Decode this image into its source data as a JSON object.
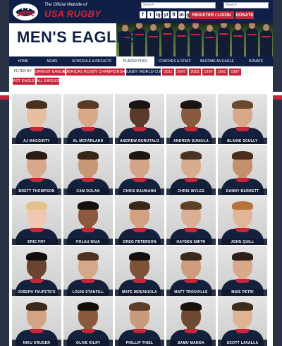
{
  "header": {
    "logo_subtitle": "The Official Website of",
    "logo_title": "USA RUGBY",
    "search_placeholder_1": "Search",
    "search_placeholder_2": "Search",
    "social_icons": [
      "f",
      "t",
      "ig",
      "yt",
      "fl",
      "in",
      "g+"
    ],
    "register_login_label": "REGISTER / LOGIN",
    "donate_label": "DONATE"
  },
  "banner": {
    "title": "MEN'S EAGLES"
  },
  "nav": {
    "items": [
      {
        "label": "HOME"
      },
      {
        "label": "NEWS"
      },
      {
        "label": "SCHEDULE & RESULTS"
      },
      {
        "label": "PLAYER POOL"
      },
      {
        "label": "COACHES & STAFF"
      },
      {
        "label": "BECOME AN EAGLE"
      },
      {
        "label": "DONATE"
      }
    ],
    "active": "PLAYER POOL"
  },
  "filters": {
    "label": "FILTER BY:",
    "options": [
      {
        "label": "CURRENT EAGLES"
      },
      {
        "label": "AMERICAS RUGBY CHAMPIONSHIP"
      },
      {
        "label": "RUGBY WORLD CUP"
      },
      {
        "label": "2011"
      },
      {
        "label": "2007"
      },
      {
        "label": "2003"
      },
      {
        "label": "1999"
      },
      {
        "label": "1991"
      },
      {
        "label": "1987"
      },
      {
        "label": "PAST EAGLES"
      },
      {
        "label": "ALL EAGLES"
      }
    ],
    "active": "RUGBY WORLD CUP"
  },
  "players": [
    {
      "name": "AJ MACGINTY"
    },
    {
      "name": "AL MCFARLAND"
    },
    {
      "name": "ANDREW DURUTALO"
    },
    {
      "name": "ANDREW SUNIULA"
    },
    {
      "name": "BLAINE SCULLY"
    },
    {
      "name": "BRETT THOMPSON"
    },
    {
      "name": "CAM DOLAN"
    },
    {
      "name": "CHRIS BAUMANN"
    },
    {
      "name": "CHRIS WYLES"
    },
    {
      "name": "DANNY BARRETT"
    },
    {
      "name": "ERIC FRY"
    },
    {
      "name": "FOLAU NIUA"
    },
    {
      "name": "GREG PETERSON"
    },
    {
      "name": "HAYDEN SMITH"
    },
    {
      "name": "JOHN QUILL"
    },
    {
      "name": "JOSEPH TAUFETE'E"
    },
    {
      "name": "LOUIS STANFILL"
    },
    {
      "name": "MATE MOEAKIOLA"
    },
    {
      "name": "MATT TROUVILLE"
    },
    {
      "name": "MIKE PETRI"
    },
    {
      "name": "NIKU KRUGER"
    },
    {
      "name": "OLIVE KILIFI"
    },
    {
      "name": "PHILLIP THIEL"
    },
    {
      "name": "SAMU MANOA"
    },
    {
      "name": "SCOTT LAVALLA"
    }
  ],
  "colors": {
    "navy": "#0f1f45",
    "red": "#c4263a",
    "background": "#2a3245"
  }
}
